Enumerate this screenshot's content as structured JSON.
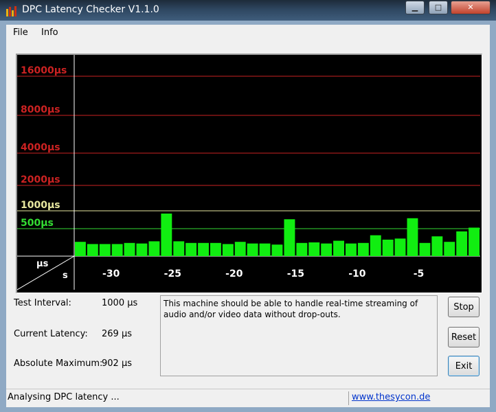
{
  "window": {
    "title": "DPC Latency Checker V1.1.0",
    "minimize_glyph": "▁",
    "maximize_glyph": "□",
    "close_glyph": "✕",
    "app_icon": "bar-chart-icon"
  },
  "menu": {
    "file": "File",
    "info": "Info"
  },
  "chart_data": {
    "type": "bar",
    "y_scale": "log2 latency levels",
    "y_ticks": [
      "16000µs",
      "8000µs",
      "4000µs",
      "2000µs",
      "1000µs",
      "500µs"
    ],
    "y_tick_colors": [
      "#cc2222",
      "#cc2222",
      "#cc2222",
      "#cc2222",
      "#e8e8a0",
      "#33dd33"
    ],
    "x_ticks": [
      "-30",
      "-25",
      "-20",
      "-15",
      "-10",
      "-5"
    ],
    "corner_top": "µs",
    "corner_bottom": "s",
    "x_range": [
      -33,
      0
    ],
    "values": [
      260,
      220,
      220,
      220,
      240,
      230,
      270,
      900,
      270,
      240,
      240,
      240,
      220,
      260,
      230,
      230,
      210,
      720,
      240,
      250,
      230,
      280,
      230,
      240,
      380,
      300,
      320,
      750,
      240,
      360,
      260,
      450,
      520
    ],
    "bar_color": "#11ee11"
  },
  "info": {
    "test_interval_label": "Test Interval:",
    "test_interval_value": "1000 µs",
    "current_latency_label": "Current Latency:",
    "current_latency_value": "269 µs",
    "absolute_maximum_label": "Absolute Maximum:",
    "absolute_maximum_value": "902 µs"
  },
  "message": "This machine should be able to handle real-time streaming of audio and/or video data without drop-outs.",
  "buttons": {
    "stop": "Stop",
    "reset": "Reset",
    "exit": "Exit"
  },
  "status": {
    "text": "Analysing DPC latency ...",
    "link": "www.thesycon.de"
  }
}
